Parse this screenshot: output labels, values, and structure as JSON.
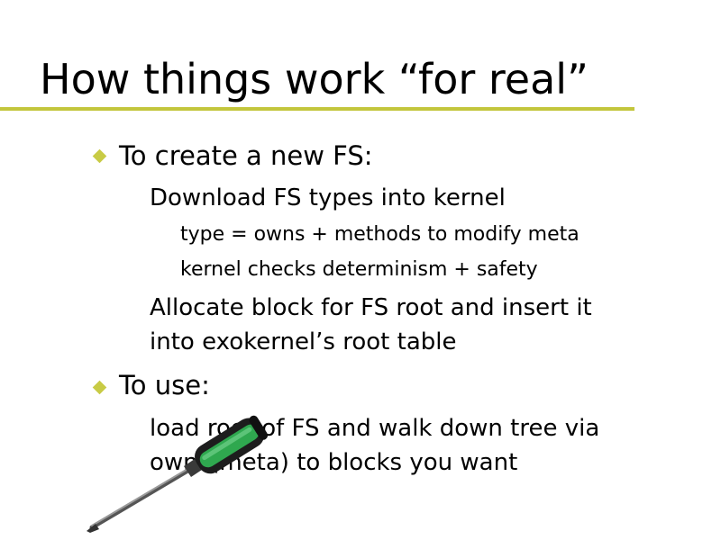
{
  "slide": {
    "title": "How things work “for real”",
    "accent_color": "#c3c63c",
    "bullet_color": "#c8cb45",
    "sections": [
      {
        "heading": "To create a new FS:",
        "sub": [
          {
            "text": "Download FS types into kernel",
            "sub": [
              "type = owns + methods to modify meta",
              "kernel checks determinism + safety"
            ]
          },
          {
            "lines": [
              "Allocate block for FS root and insert it",
              "into exokernel’s root table"
            ]
          }
        ]
      },
      {
        "heading": "To use:",
        "sub": [
          {
            "lines": [
              "load root of FS and walk down tree via",
              "owns(meta) to blocks you want"
            ]
          }
        ]
      }
    ],
    "image": {
      "icon": "screwdriver-icon"
    }
  }
}
